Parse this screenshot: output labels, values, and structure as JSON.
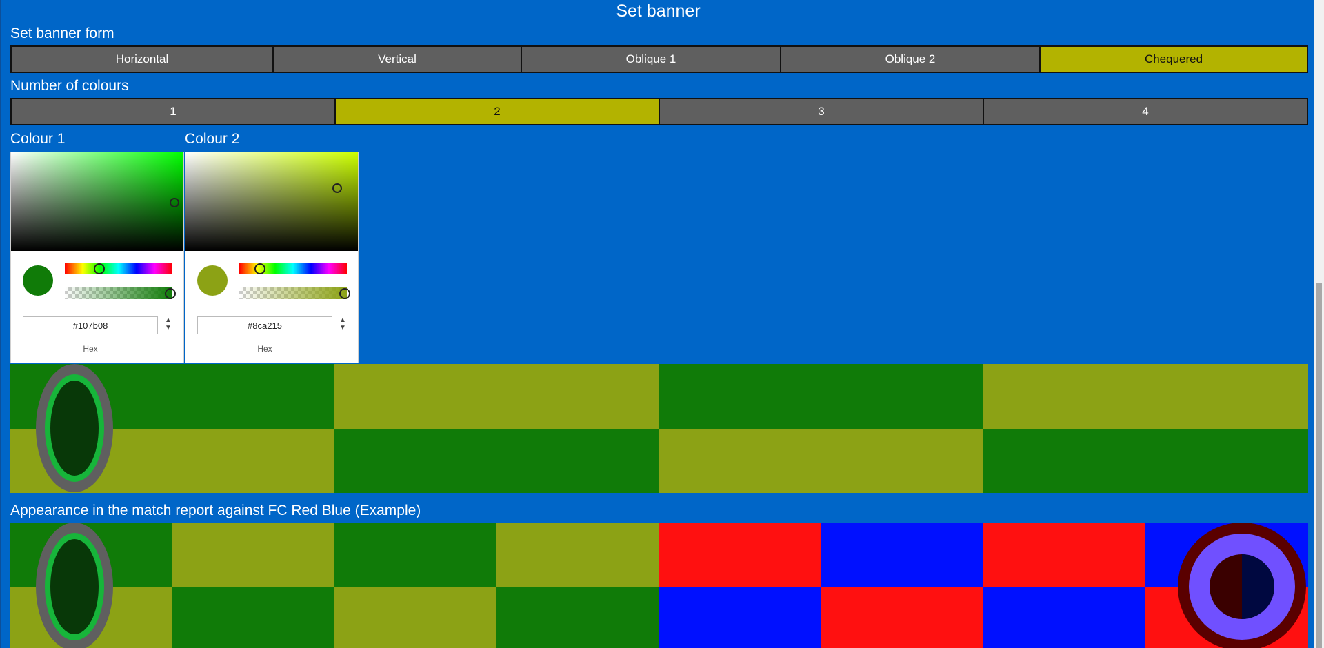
{
  "title": "Set banner",
  "form": {
    "heading": "Set banner form",
    "options": [
      "Horizontal",
      "Vertical",
      "Oblique 1",
      "Oblique 2",
      "Chequered"
    ],
    "selected": "Chequered"
  },
  "colours": {
    "heading": "Number of colours",
    "options": [
      "1",
      "2",
      "3",
      "4"
    ],
    "selected": "2"
  },
  "pickers": [
    {
      "label": "Colour 1",
      "hex": "#107b08",
      "format": "Hex"
    },
    {
      "label": "Colour 2",
      "hex": "#8ca215",
      "format": "Hex"
    }
  ],
  "match_report": {
    "heading": "Appearance in the match report against FC Red Blue (Example)"
  },
  "colors": {
    "background": "#0066c8",
    "button": "#5f5f5f",
    "button_selected": "#b3b300",
    "colour_1": "#107b08",
    "colour_2": "#8ca215",
    "opponent_red": "#ff1010",
    "opponent_blue": "#0010ff"
  }
}
